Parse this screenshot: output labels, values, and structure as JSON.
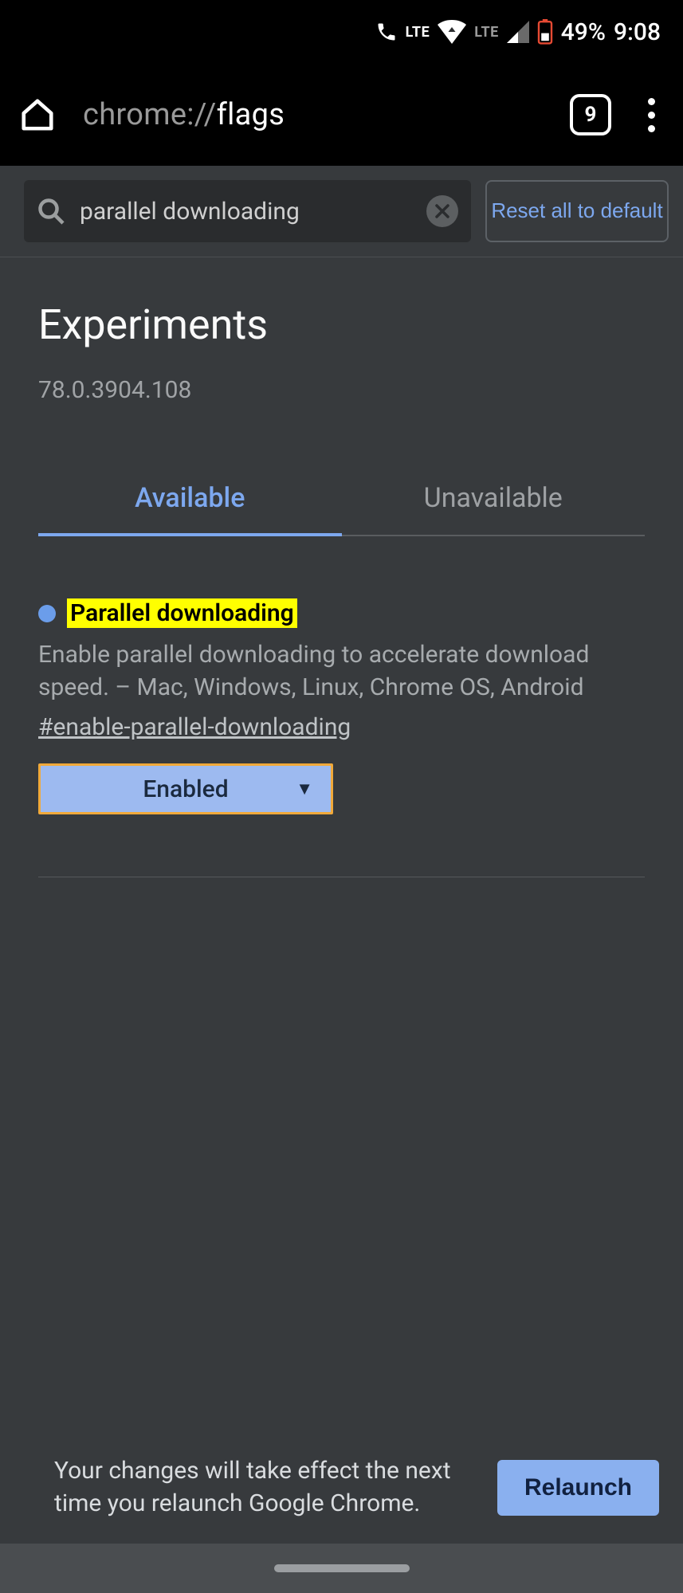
{
  "status": {
    "battery": "49%",
    "time": "9:08",
    "lte1": "LTE",
    "lte2": "LTE"
  },
  "toolbar": {
    "url_scheme": "chrome://",
    "url_path": "flags",
    "tab_count": "9"
  },
  "search": {
    "value": "parallel downloading",
    "reset_label": "Reset all to default"
  },
  "header": {
    "title": "Experiments",
    "version": "78.0.3904.108"
  },
  "tabs": {
    "available": "Available",
    "unavailable": "Unavailable"
  },
  "flag": {
    "title": "Parallel downloading",
    "description": "Enable parallel downloading to accelerate download speed. – Mac, Windows, Linux, Chrome OS, Android",
    "hash": "#enable-parallel-downloading",
    "selected": "Enabled"
  },
  "relaunch": {
    "message": "Your changes will take effect the next time you relaunch Google Chrome.",
    "button": "Relaunch"
  }
}
